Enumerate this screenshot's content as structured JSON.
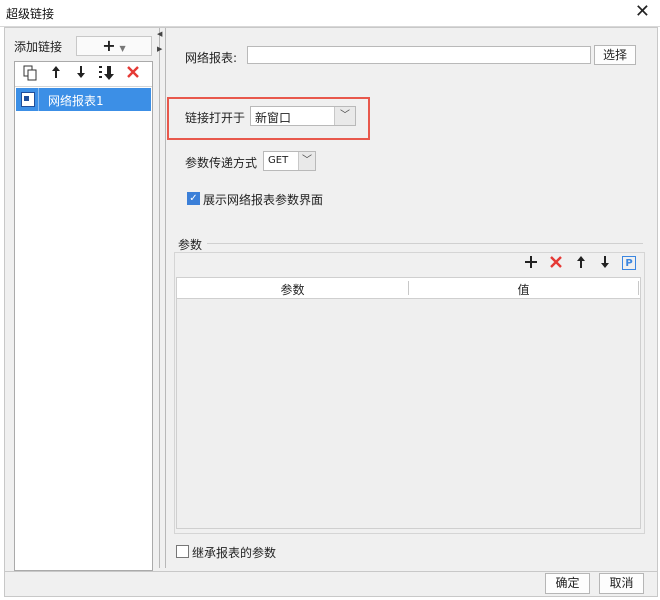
{
  "window": {
    "title": "超级链接"
  },
  "left": {
    "add_label": "添加链接",
    "add_button": "+",
    "items": [
      {
        "label": "网络报表1"
      }
    ]
  },
  "right": {
    "report_label": "网络报表:",
    "report_value": "",
    "select_button": "选择",
    "open_in_label": "链接打开于",
    "open_in_value": "新窗口",
    "param_method_label": "参数传递方式",
    "param_method_value": "GET",
    "show_params_label": "展示网络报表参数界面",
    "show_params_checked": true,
    "params_group_label": "参数",
    "table_headers": [
      "参数",
      "值"
    ],
    "inherit_label": "继承报表的参数",
    "inherit_checked": false
  },
  "footer": {
    "ok": "确定",
    "cancel": "取消"
  },
  "colors": {
    "selection": "#3c8fe6",
    "highlight": "#e8584c",
    "delete": "#e53935"
  },
  "icons": [
    "close-icon",
    "copy-icon",
    "arrow-up-icon",
    "arrow-down-icon",
    "move-bottom-icon",
    "delete-icon",
    "report-icon",
    "chevron-down-icon",
    "plus-icon",
    "param-icon"
  ]
}
